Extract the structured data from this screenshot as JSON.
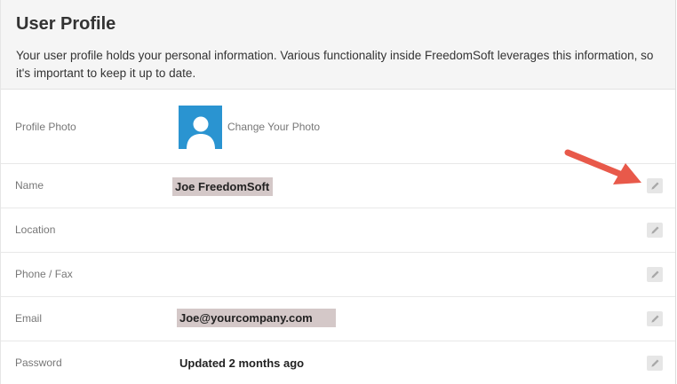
{
  "header": {
    "title": "User Profile",
    "description": "Your user profile holds your personal information. Various functionality inside FreedomSoft leverages this information, so it's important to keep it up to date."
  },
  "profile_photo": {
    "label": "Profile Photo",
    "change_link": "Change Your Photo",
    "avatar_color": "#2a94d1"
  },
  "rows": {
    "name": {
      "label": "Name",
      "value": "Joe FreedomSoft"
    },
    "location": {
      "label": "Location",
      "value": ""
    },
    "phone": {
      "label": "Phone / Fax",
      "value": ""
    },
    "email": {
      "label": "Email",
      "value": "Joe@yourcompany.com"
    },
    "password": {
      "label": "Password",
      "value": "Updated 2 months ago"
    }
  },
  "colors": {
    "highlight": "#d4c8c8",
    "arrow": "#e8594a",
    "edit_button_bg": "#e6e6e6"
  },
  "icons": {
    "edit": "pencil-icon",
    "avatar": "user-silhouette-icon",
    "annotation": "red-arrow-icon"
  }
}
